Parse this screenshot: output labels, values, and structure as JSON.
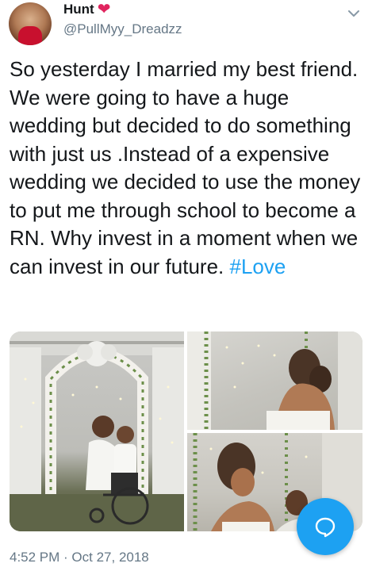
{
  "author": {
    "display_name": "Hunt",
    "handle": "@PullMyy_Dreadzz",
    "badge_icon": "heart-icon",
    "avatar": "avatar"
  },
  "tweet": {
    "text": "So yesterday I married my best friend. We were going to have a huge wedding but decided to do something with just us .Instead of a expensive wedding we decided to use the money to put me through school to become a RN. Why invest in a moment when we can invest in our future. ",
    "hashtag": "#Love",
    "timestamp": "4:52 PM · Oct 27, 2018"
  },
  "media": {
    "count": 3,
    "photos": [
      {
        "name": "wedding-arch-photo"
      },
      {
        "name": "embrace-photo"
      },
      {
        "name": "couple-closeup-photo"
      }
    ]
  },
  "icons": {
    "menu": "chevron-down-icon",
    "compose": "reply-bubble-icon"
  },
  "colors": {
    "accent": "#1da1f2",
    "heart": "#e0245e",
    "secondary_text": "#657786"
  }
}
